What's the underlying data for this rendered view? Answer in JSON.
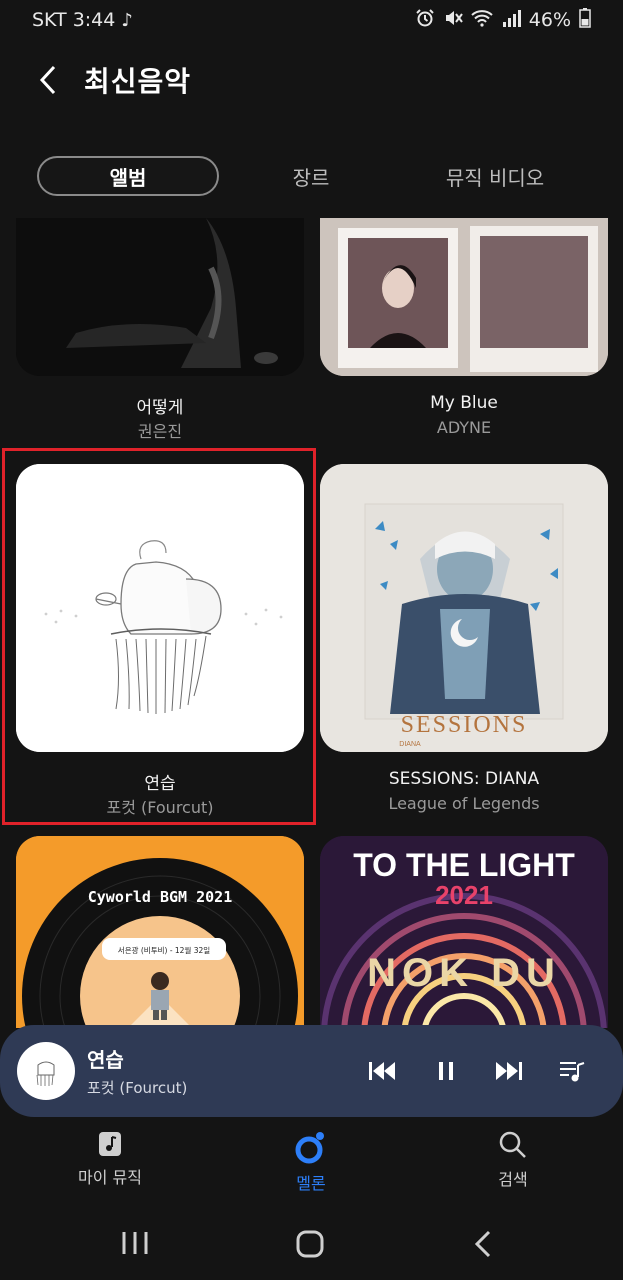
{
  "status_bar": {
    "carrier_time": "SKT 3:44",
    "battery": "46%"
  },
  "header": {
    "title": "최신음악"
  },
  "tabs": [
    {
      "label": "앨범"
    },
    {
      "label": "장르"
    },
    {
      "label": "뮤직 비디오"
    }
  ],
  "albums": [
    {
      "title": "어떻게",
      "artist": "권은진"
    },
    {
      "title": "My Blue",
      "artist": "ADYNE"
    },
    {
      "title": "연습",
      "artist": "포컷 (Fourcut)"
    },
    {
      "title": "SESSIONS: DIANA",
      "artist": "League of Legends"
    },
    {
      "cover_text": "Cyworld BGM 2021",
      "cover_subtext": "서은광 (비투비) - 12월 32일"
    },
    {
      "cover_text": "TO THE LIGHT",
      "cover_year": "2021",
      "cover_logo": "NOK DU"
    }
  ],
  "sessions_cover": {
    "logo": "SESSIONS",
    "sub": "DIANA"
  },
  "mini_player": {
    "title": "연습",
    "artist": "포컷 (Fourcut)"
  },
  "bottom_nav": [
    {
      "label": "마이 뮤직"
    },
    {
      "label": "멜론"
    },
    {
      "label": "검색"
    }
  ],
  "colors": {
    "accent": "#2d7ff9",
    "highlight": "#e0222a",
    "player_bg": "#2f3a55"
  }
}
